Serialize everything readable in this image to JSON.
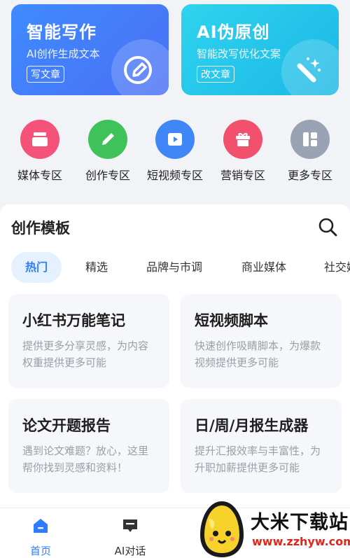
{
  "cards": [
    {
      "title": "智能写作",
      "subtitle": "AI创作生成文本",
      "button": "写文章"
    },
    {
      "title": "AI伪原创",
      "subtitle": "智能改写优化文案",
      "button": "改文章"
    }
  ],
  "categories": [
    {
      "label": "媒体专区",
      "color": "#f5527a",
      "icon": "media-icon"
    },
    {
      "label": "创作专区",
      "color": "#3fc25a",
      "icon": "pen-icon"
    },
    {
      "label": "短视频专区",
      "color": "#3f86f7",
      "icon": "video-icon"
    },
    {
      "label": "营销专区",
      "color": "#f2516e",
      "icon": "gift-icon"
    },
    {
      "label": "更多专区",
      "color": "#9aa3b4",
      "icon": "grid-icon"
    }
  ],
  "templates": {
    "title": "创作模板",
    "tabs": [
      "热门",
      "精选",
      "品牌与市调",
      "商业媒体",
      "社交媒"
    ],
    "active_tab": "热门",
    "items": [
      {
        "title": "小红书万能笔记",
        "desc": "提供更多分享灵感，为内容权重提供更多可能"
      },
      {
        "title": "短视频脚本",
        "desc": "快速创作吸睛脚本，为爆款视频提供更多可能"
      },
      {
        "title": "论文开题报告",
        "desc": "遇到论文难题？放心，这里帮你找到灵感和资料！"
      },
      {
        "title": "日/周/月报生成器",
        "desc": "提升汇报效率与丰富性，为升职加薪提供更多可能"
      }
    ]
  },
  "nav": [
    {
      "label": "首页",
      "active": true,
      "color": "#2e7dff"
    },
    {
      "label": "AI对话",
      "active": false,
      "color": "#333333"
    }
  ],
  "watermark": {
    "name": "大米下载站",
    "url": "www.zzhyw.com"
  }
}
